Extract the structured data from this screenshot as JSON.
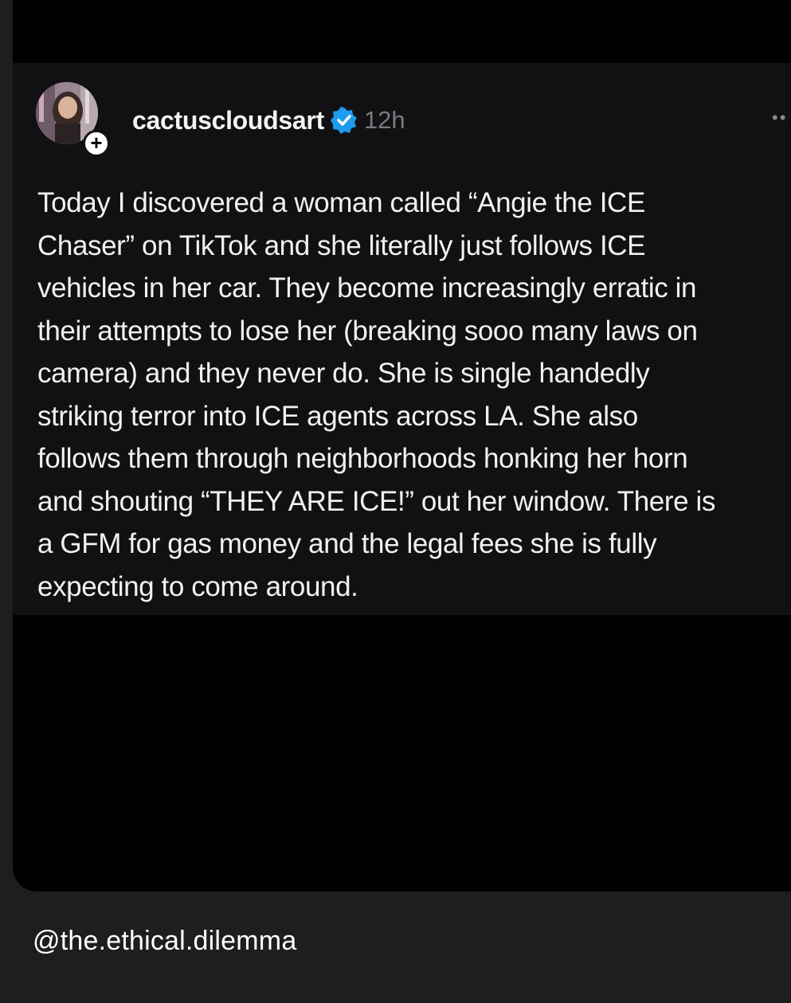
{
  "post": {
    "username": "cactuscloudsart",
    "timestamp": "12h",
    "follow_symbol": "+",
    "more_symbol": "••",
    "lines": [
      "Today I discovered a woman called “Angie the ICE",
      "Chaser” on TikTok and she literally just follows ICE",
      "vehicles in her car. They become increasingly erratic in",
      "their attempts to lose her (breaking sooo many laws on",
      "camera) and they never do. She is single handedly",
      "striking terror into ICE agents across LA. She also",
      "follows them through neighborhoods honking her horn",
      "and shouting “THEY ARE ICE!” out her window. There is",
      "a GFM for gas money and the legal fees she is fully",
      "expecting to come around."
    ],
    "icons": {
      "avatar": "avatar-photo",
      "verified": "verified-badge-icon",
      "follow": "plus-icon",
      "more": "more-options-icon"
    }
  },
  "watermark": {
    "handle": "@the.ethical.dilemma"
  },
  "colors": {
    "background": "#1e1e20",
    "post_background": "#111113",
    "verified_blue": "#1d9bf0",
    "timestamp_gray": "#7b7b80"
  }
}
